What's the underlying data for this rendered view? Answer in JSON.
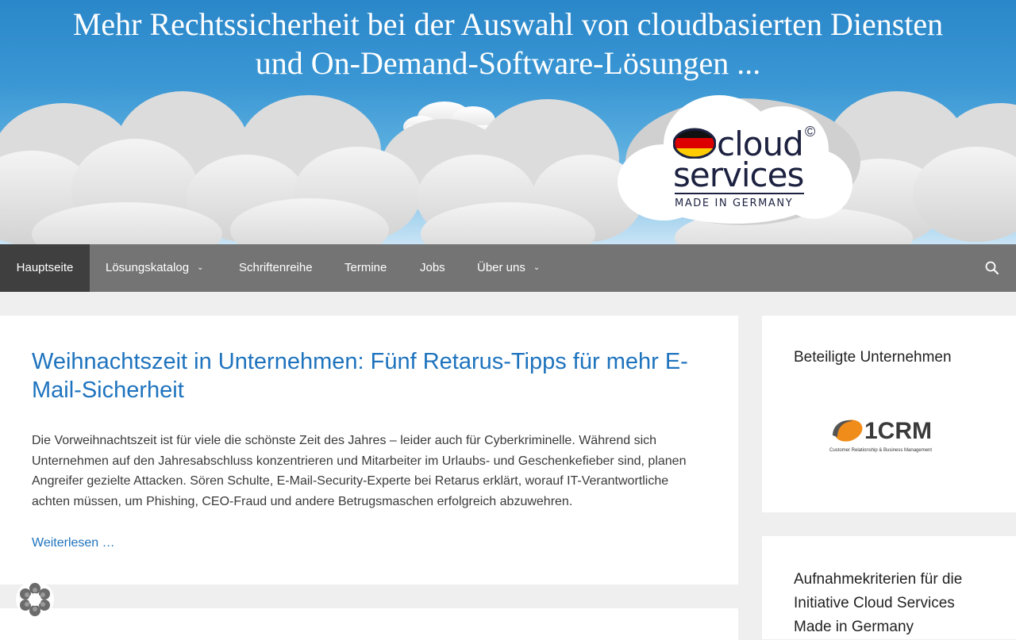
{
  "header": {
    "title_line1": "Mehr Rechtssicherheit bei der Auswahl von cloudbasierten Diensten",
    "title_line2": "und On-Demand-Software-Lösungen ...",
    "logo": {
      "word1": "cloud",
      "word2": "services",
      "tagline": "MADE IN GERMANY",
      "copyright": "©"
    }
  },
  "nav": {
    "items": [
      {
        "label": "Hauptseite",
        "active": true
      },
      {
        "label": "Lösungskatalog",
        "dropdown": true
      },
      {
        "label": "Schriftenreihe"
      },
      {
        "label": "Termine"
      },
      {
        "label": "Jobs"
      },
      {
        "label": "Über uns",
        "dropdown": true
      }
    ],
    "search_icon": "search-icon"
  },
  "main": {
    "article": {
      "title": "Weihnachtszeit in Unternehmen: Fünf Retarus-Tipps für mehr E-Mail-Sicherheit",
      "body": "Die Vorweihnachtszeit ist für viele die schönste Zeit des Jahres – leider auch für Cyberkriminelle. Während sich Unternehmen auf den Jahresabschluss konzentrieren und Mitarbeiter im Urlaubs- und Geschenkefieber sind, planen Angreifer gezielte Attacken. Sören Schulte, E-Mail-Security-Experte bei Retarus erklärt, worauf IT-Verantwortliche achten müssen, um Phishing, CEO-Fraud und andere Betrugsmaschen erfolgreich abzuwehren.",
      "read_more": "Weiterlesen …"
    }
  },
  "sidebar": {
    "widget1": {
      "title": "Beteiligte Unternehmen",
      "logo_text": "1CRM",
      "logo_sub": "Customer Relationship & Business Management"
    },
    "widget2": {
      "title": "Aufnahmekriterien für die Initiative Cloud Services Made in Germany"
    }
  },
  "colors": {
    "link": "#1e73be",
    "nav_bg": "#747474",
    "nav_active": "#3f3f3f",
    "page_bg": "#efefef",
    "header_blue": "#2a87c9"
  }
}
